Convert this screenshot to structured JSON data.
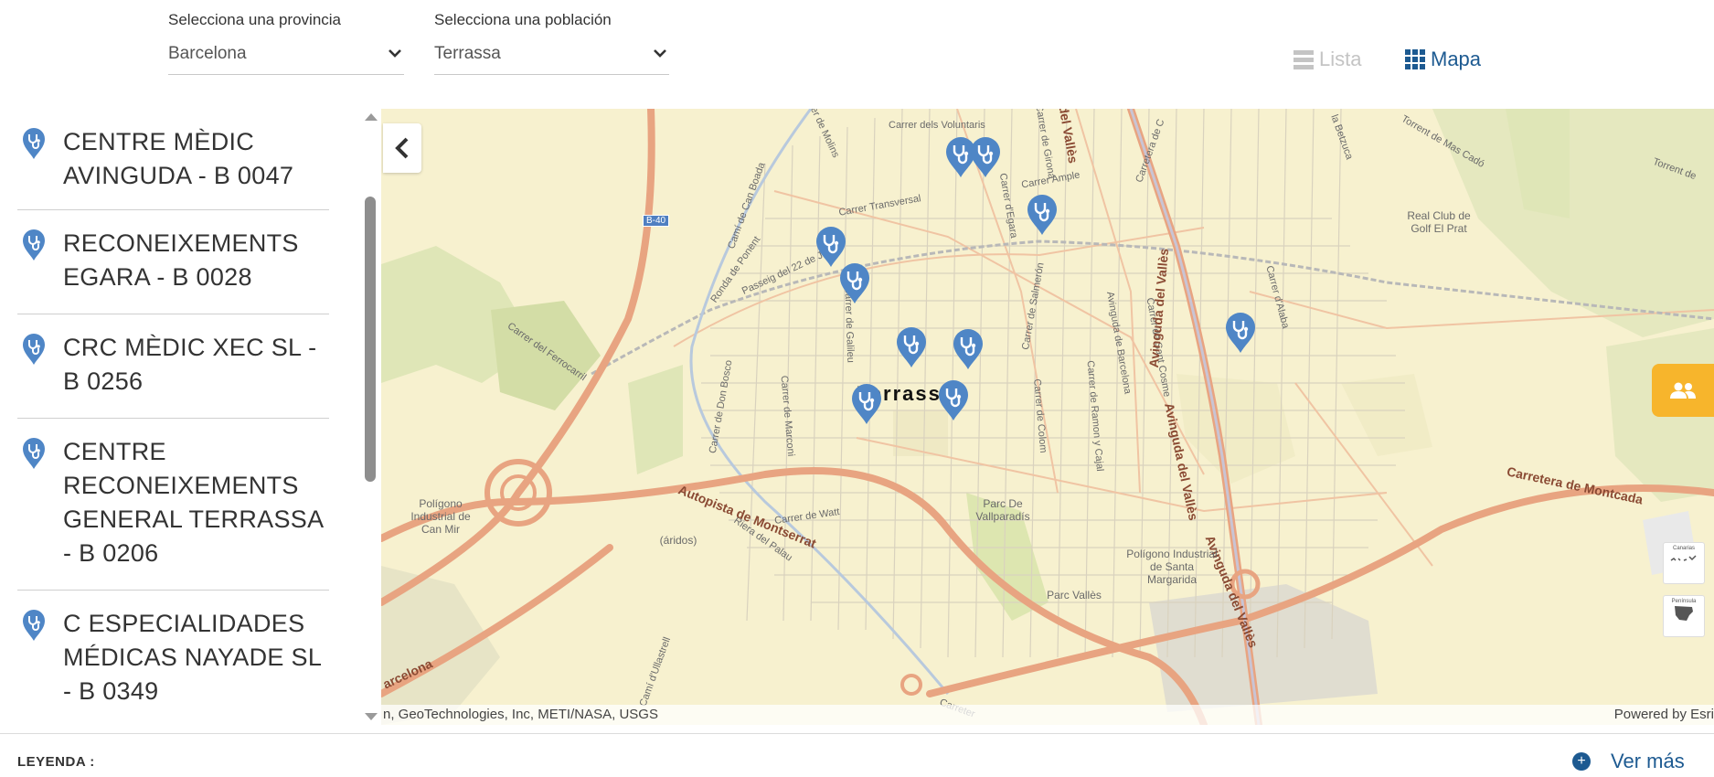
{
  "filters": {
    "provincia": {
      "label": "Selecciona una provincia",
      "value": "Barcelona"
    },
    "poblacion": {
      "label": "Selecciona una población",
      "value": "Terrassa"
    }
  },
  "view_toggle": {
    "lista": "Lista",
    "mapa": "Mapa",
    "active": "Mapa"
  },
  "centers": [
    {
      "name": "CENTRE MÈDIC AVINGUDA - B 0047"
    },
    {
      "name": "RECONEIXEMENTS EGARA - B 0028"
    },
    {
      "name": "CRC MÈDIC XEC SL - B 0256"
    },
    {
      "name": "CENTRE RECONEIXEMENTS GENERAL TERRASSA - B 0206"
    },
    {
      "name": "C ESPECIALIDADES MÉDICAS NAYADE SL - B 0349"
    }
  ],
  "map": {
    "city": "Terrassa",
    "attribution_left": "n, GeoTechnologies, Inc, METI/NASA, USGS",
    "attribution_right": "Powered by Esri",
    "inset_canarias": "Canarias",
    "inset_peninsula": "Península",
    "streets": {
      "voluntaris": "Carrer dels Voluntaris",
      "transversal": "Carrer Transversal",
      "ample": "Carrer Ample",
      "egara": "Carrer d'Egara",
      "girona": "Carrer de Girona",
      "salmeron": "Carrer de Salmerón",
      "juliol": "Passeig del 22 de Juliol",
      "poniente": "Ronda de Ponent",
      "canboada": "Camí de Can Boada",
      "ferrocarril": "Carrer del Ferrocarril",
      "donbosco": "Carrer de Don Bosco",
      "marconi": "Carrer de Marconi",
      "galileu": "Carrer de Galileu",
      "watt": "Carrer de Watt",
      "riera": "Riera del Palau",
      "barcelona_av": "Avinguda de Barcelona",
      "santcosme": "Carrer de Sant Cosme",
      "ramonycajal": "Carrer de Ramon y Cajal",
      "colom": "Carrer de Colom",
      "alaba": "Carrer d'Alaba",
      "ullastrell": "Camí d'Ullastrell",
      "molins": "Carrer de Molins",
      "labetzuca": "la Betzuca",
      "masca": "Torrent de Mas Cadó",
      "torrent": "Torrent de",
      "carretera_c": "Carretera de C",
      "carreter": "Carreter"
    },
    "highways": {
      "b40": "B-40",
      "autopista": "Autopista de Montserrat",
      "montcada": "Carretera de Montcada",
      "valles1": "Avinguda del Vallès",
      "valles2": "Avinguda del Vallès",
      "valles3": "Avinguda del Vallès",
      "delvalles": "del Vallès",
      "barcelona": "arcelona"
    },
    "areas": {
      "canmir": "Polígono Industrial de Can Mir",
      "aridos": "(áridos)",
      "vallparadis": "Parc De Vallparadís",
      "santamargarida": "Polígono Industrial de Santa Margarida",
      "parcvalles": "Parc Vallès",
      "golf": "Real Club de Golf El Prat"
    }
  },
  "footer": {
    "legend": "LEYENDA :",
    "ver_mas": "Ver más"
  },
  "colors": {
    "accent": "#1d5a91",
    "marker": "#4f86c6",
    "people_btn": "#f7b52c",
    "map_bg": "#f7f1cf",
    "highway": "#e8a481"
  }
}
